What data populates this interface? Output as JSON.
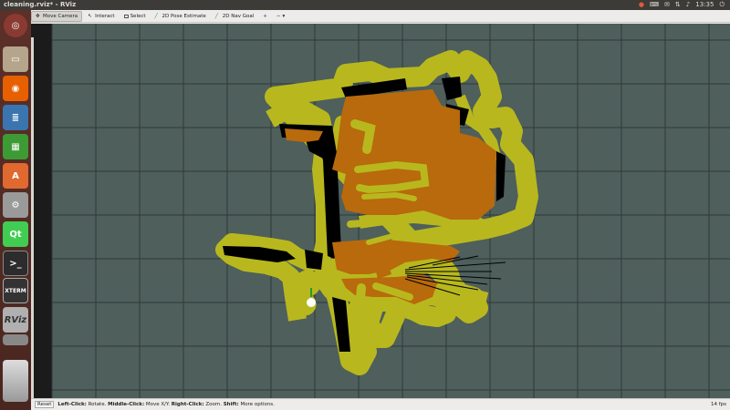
{
  "topbar": {
    "title": "cleaning.rviz* - RViz",
    "tray": {
      "time": "13:35"
    }
  },
  "launcher": {
    "items": [
      {
        "name": "ubuntu-dash",
        "label": ""
      },
      {
        "name": "files",
        "label": ""
      },
      {
        "name": "firefox",
        "label": ""
      },
      {
        "name": "libreoffice-writer",
        "label": ""
      },
      {
        "name": "libreoffice-calc",
        "label": ""
      },
      {
        "name": "software-center",
        "label": "A"
      },
      {
        "name": "system-settings",
        "label": ""
      },
      {
        "name": "qt-creator",
        "label": "Qt"
      },
      {
        "name": "terminal",
        "label": ">_"
      },
      {
        "name": "xterm",
        "label": "XTERM"
      },
      {
        "name": "rviz",
        "label": "RViz"
      }
    ]
  },
  "toolbar": {
    "move_camera": "Move Camera",
    "interact": "Interact",
    "select": "Select",
    "pose_estimate": "2D Pose Estimate",
    "nav_goal": "2D Nav Goal"
  },
  "status": {
    "reset": "Reset",
    "left_click": "Left-Click:",
    "left_click_desc": "Rotate.",
    "middle_click": "Middle-Click:",
    "middle_click_desc": "Move X/Y.",
    "right_click": "Right-Click:",
    "right_click_desc": "Zoom.",
    "shift": "Shift:",
    "shift_desc": "More options.",
    "fps": "14 fps"
  },
  "colors": {
    "grid_bg": "#4e5f5c",
    "grid_line": "#2f3a38",
    "costmap_yellow": "#b8b81e",
    "free_orange": "#b86a0c",
    "wall_black": "#000000",
    "launcher_bg": "#5b3028",
    "toolbar_bg": "#edecea"
  }
}
